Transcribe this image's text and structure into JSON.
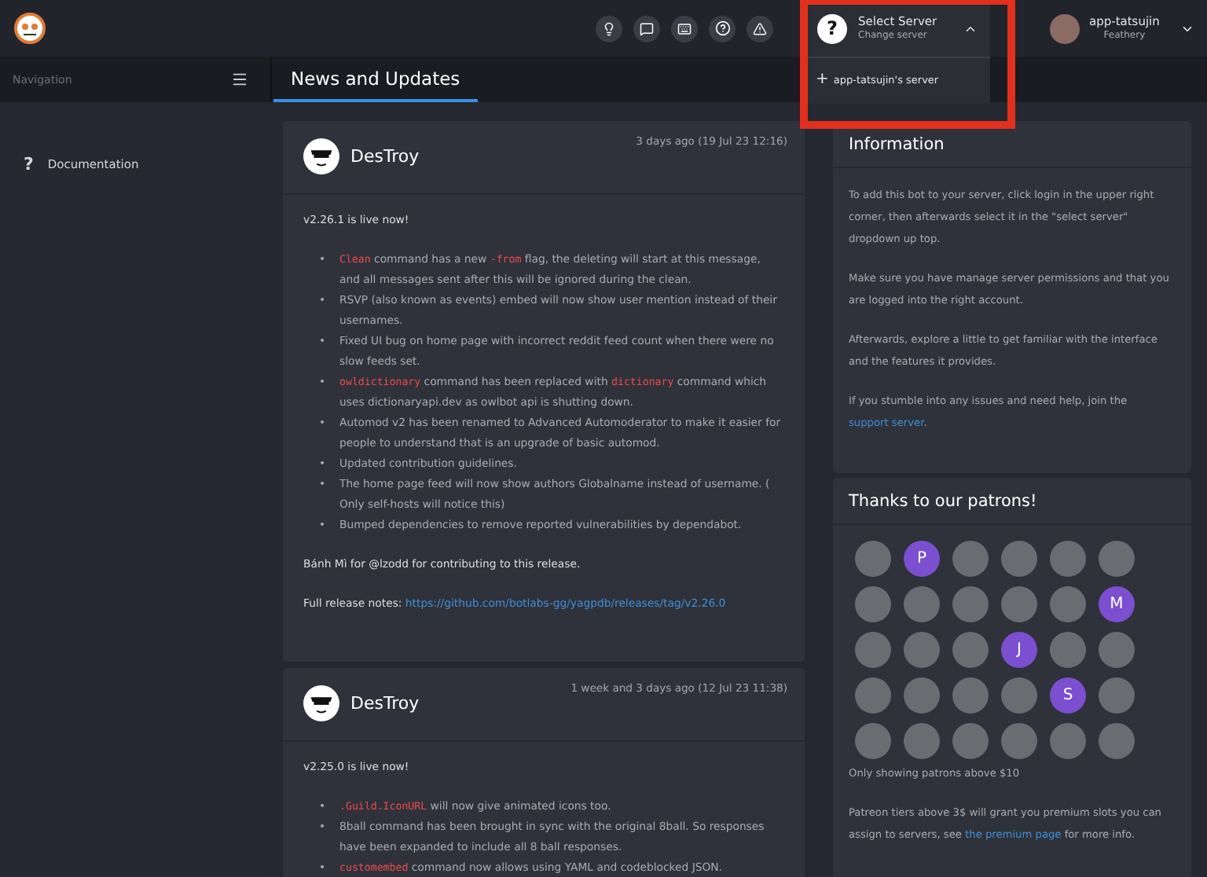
{
  "topbar": {
    "server_selector": {
      "title": "Select Server",
      "subtitle": "Change server",
      "icon": "?",
      "expanded": true
    },
    "server_menu": [
      {
        "icon": "+",
        "label": "app-tatsujin's server"
      }
    ],
    "user": {
      "name": "app-tatsujin",
      "subtitle": "Feathery"
    }
  },
  "sidebar": {
    "title": "Navigation",
    "items": [
      {
        "icon": "?",
        "label": "Documentation"
      }
    ]
  },
  "tabs": [
    {
      "label": "News and Updates",
      "selected": true
    }
  ],
  "posts": [
    {
      "author": "DesTroy",
      "time": "3 days ago (19 Jul 23 12:16)",
      "intro": "v2.26.1 is live now!",
      "bullets": [
        {
          "marker": "•",
          "segments": [
            {
              "text": "Clean",
              "code": true
            },
            {
              "text": " command has a new ",
              "code": false
            },
            {
              "text": "-from",
              "code": true
            },
            {
              "text": " flag, the deleting will start at this message, and all messages sent after this will be ignored during the clean.",
              "code": false
            }
          ]
        },
        {
          "marker": "•",
          "segments": [
            {
              "text": "RSVP (also known as events) embed will now show user mention instead of their usernames.",
              "code": false
            }
          ]
        },
        {
          "marker": "•",
          "segments": [
            {
              "text": "Fixed UI bug on home page with incorrect reddit feed count when there were no slow feeds set.",
              "code": false
            }
          ]
        },
        {
          "marker": "•",
          "segments": [
            {
              "text": "owldictionary",
              "code": true
            },
            {
              "text": " command has been replaced with ",
              "code": false
            },
            {
              "text": "dictionary",
              "code": true
            },
            {
              "text": " command which uses dictionaryapi.dev as owlbot api is shutting down.",
              "code": false
            }
          ]
        },
        {
          "marker": "•",
          "segments": [
            {
              "text": "Automod v2 has been renamed to Advanced Automoderator to make it easier for people to understand that is an upgrade of basic automod.",
              "code": false
            }
          ]
        },
        {
          "marker": "•",
          "segments": [
            {
              "text": "Updated contribution guidelines.",
              "code": false
            }
          ]
        },
        {
          "marker": "•",
          "segments": [
            {
              "text": "The home page feed will now show authors Globalname instead of username. ( Only self-hosts will notice this)",
              "code": false
            }
          ]
        },
        {
          "marker": "•",
          "segments": [
            {
              "text": "Bumped dependencies to remove reported vulnerabilities by dependabot.",
              "code": false
            }
          ]
        }
      ],
      "thanks": "Bánh Mì for @lzodd for contributing to this release.",
      "notes_label": "Full release notes: ",
      "notes_link": "https://github.com/botlabs-gg/yagpdb/releases/tag/v2.26.0"
    },
    {
      "author": "DesTroy",
      "time": "1 week and 3 days ago (12 Jul 23 11:38)",
      "intro": "v2.25.0 is live now!",
      "bullets": [
        {
          "marker": "•",
          "segments": [
            {
              "text": ".Guild.IconURL",
              "code": true
            },
            {
              "text": " will now give animated icons too.",
              "code": false
            }
          ]
        },
        {
          "marker": "•",
          "segments": [
            {
              "text": "8ball command has been brought in sync with the original 8ball. So responses have been expanded to include all 8 ball responses.",
              "code": false
            }
          ]
        },
        {
          "marker": "•",
          "segments": [
            {
              "text": "customembed",
              "code": true
            },
            {
              "text": " command now allows using YAML and codeblocked JSON.",
              "code": false
            }
          ]
        }
      ]
    }
  ],
  "information": {
    "title": "Information",
    "paragraphs": [
      [
        {
          "text": "To add this bot to your server, click login in the upper right corner, then afterwards select it in the \"select server\" dropdown up top.",
          "link": false
        }
      ],
      [
        {
          "text": "Make sure you have manage server permissions and that you are logged into the right account.",
          "link": false
        }
      ],
      [
        {
          "text": "Afterwards, explore a little to get familiar with the interface and the features it provides.",
          "link": false
        }
      ],
      [
        {
          "text": "If you stumble into any issues and need help, join the ",
          "link": false
        },
        {
          "text": "support server",
          "link": true
        },
        {
          "text": ".",
          "link": false
        }
      ]
    ]
  },
  "patrons": {
    "title": "Thanks to our patrons!",
    "avatars": [
      {
        "kind": "image"
      },
      {
        "kind": "letter",
        "letter": "P"
      },
      {
        "kind": "image"
      },
      {
        "kind": "image"
      },
      {
        "kind": "image"
      },
      {
        "kind": "image"
      },
      {
        "kind": "image"
      },
      {
        "kind": "image"
      },
      {
        "kind": "image"
      },
      {
        "kind": "image"
      },
      {
        "kind": "image"
      },
      {
        "kind": "letter",
        "letter": "M"
      },
      {
        "kind": "image"
      },
      {
        "kind": "image"
      },
      {
        "kind": "image"
      },
      {
        "kind": "letter",
        "letter": "J"
      },
      {
        "kind": "image"
      },
      {
        "kind": "image"
      },
      {
        "kind": "image"
      },
      {
        "kind": "image"
      },
      {
        "kind": "image"
      },
      {
        "kind": "image"
      },
      {
        "kind": "letter",
        "letter": "S"
      },
      {
        "kind": "image"
      },
      {
        "kind": "image"
      },
      {
        "kind": "image"
      },
      {
        "kind": "image"
      },
      {
        "kind": "image"
      },
      {
        "kind": "image"
      },
      {
        "kind": "image"
      }
    ],
    "note": "Only showing patrons above $10",
    "footer": [
      {
        "text": "Patreon tiers above 3$ will grant you premium slots you can assign to servers, see ",
        "link": false
      },
      {
        "text": "the premium page",
        "link": true
      },
      {
        "text": " for more info.",
        "link": false
      }
    ]
  }
}
